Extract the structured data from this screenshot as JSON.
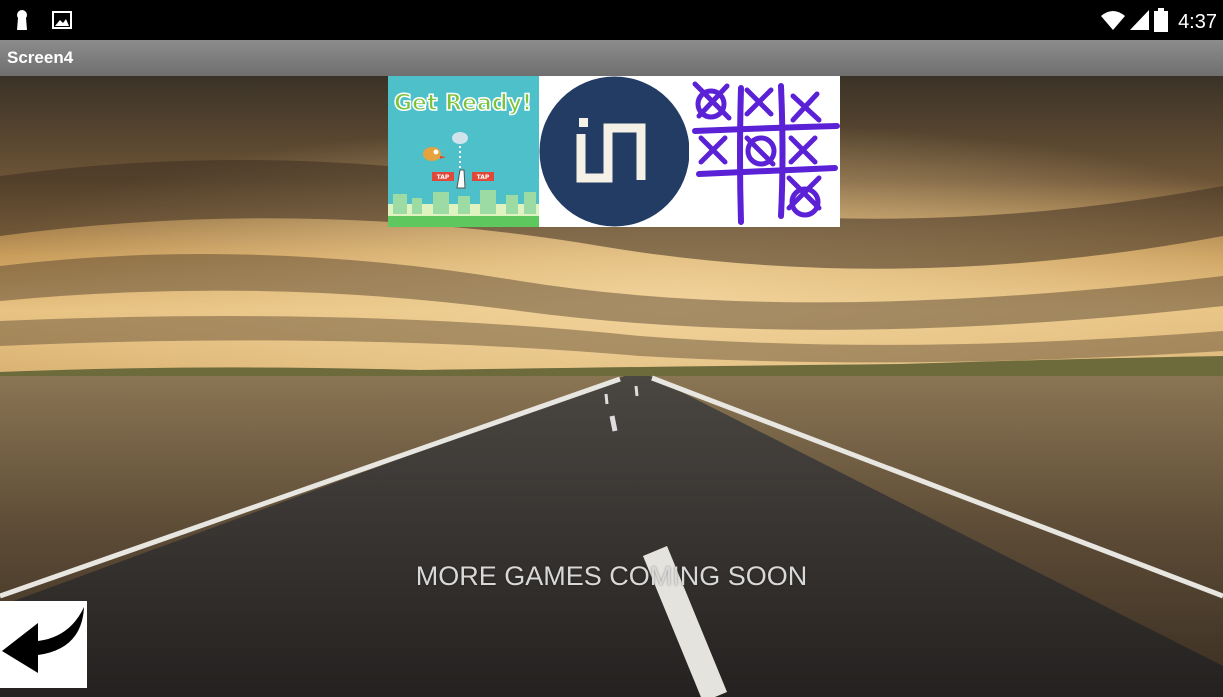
{
  "status_bar": {
    "time": "4:37",
    "left_icons": [
      "keyhole-icon",
      "image-icon"
    ],
    "right_icons": [
      "wifi-icon",
      "signal-icon",
      "battery-icon"
    ]
  },
  "app": {
    "title": "Screen4"
  },
  "games": [
    {
      "name": "flappy-bird-game",
      "icon": "flappy-bird-icon",
      "banner": "Get Ready!",
      "tap_left": "TAP",
      "tap_right": "TAP"
    },
    {
      "name": "in-game",
      "icon": "in-logo-icon"
    },
    {
      "name": "tic-tac-toe-game",
      "icon": "tic-tac-toe-icon"
    }
  ],
  "message": "MORE GAMES COMING SOON",
  "back_button": {
    "icon": "back-arrow-icon"
  },
  "colors": {
    "title_bar": "#7e7e7e",
    "flappy_sky": "#4ec0ca",
    "in_logo_bg": "#233c64",
    "tictactoe_ink": "#5b21d6"
  }
}
